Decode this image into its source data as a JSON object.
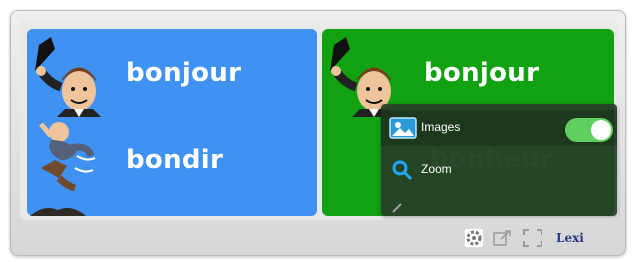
{
  "left_panel": {
    "rows": [
      {
        "word": "bonjour",
        "icon": "man-tipping-hat-icon"
      },
      {
        "word": "bondir",
        "icon": "man-jumping-icon"
      }
    ]
  },
  "right_panel": {
    "rows": [
      {
        "word": "bonjour",
        "icon": "man-tipping-hat-icon"
      }
    ],
    "obscured_word": "bonheur"
  },
  "settings_popup": {
    "images_label": "Images",
    "images_toggle": true,
    "zoom_label": "Zoom"
  },
  "toolbar": {
    "brand": "Lexi"
  },
  "colors": {
    "left_panel_bg": "#3f92f1",
    "right_panel_bg": "#10a210",
    "toggle_on": "#5fcf5f"
  }
}
